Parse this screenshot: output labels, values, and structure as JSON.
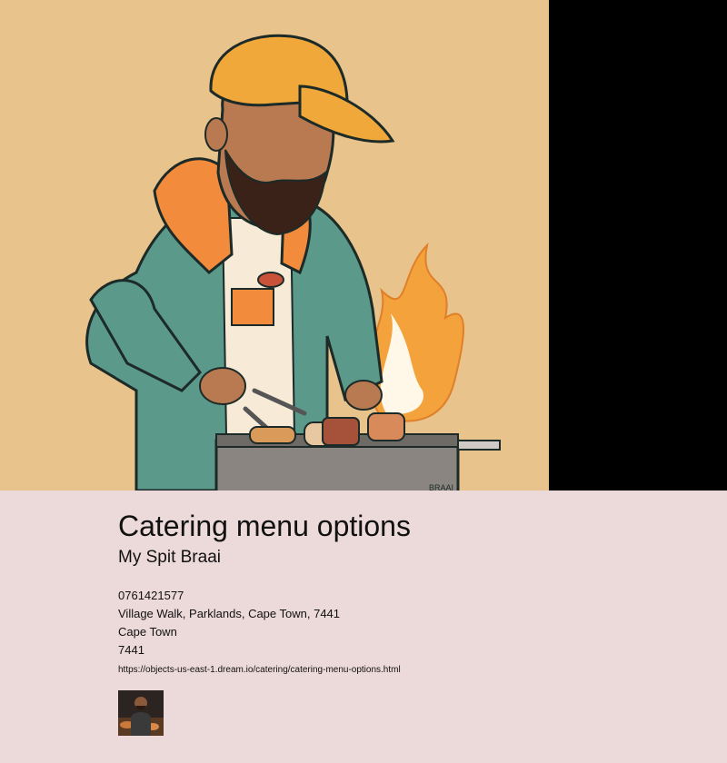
{
  "page": {
    "title": "Catering menu options",
    "business_name": "My Spit Braai",
    "phone": "0761421577",
    "address": "Village Walk, Parklands, Cape Town, 7441",
    "city": "Cape Town",
    "postal_code": "7441",
    "url": "https://objects-us-east-1.dream.io/catering/catering-menu-options.html"
  },
  "hero": {
    "grill_label": "BRAAI"
  },
  "colors": {
    "page_background": "#ecd9d9",
    "hero_background": "#e8c38b",
    "cap": "#f0a83a",
    "jacket": "#5b9a8a",
    "hood": "#f28c3c",
    "flame": "#f4a23b"
  }
}
